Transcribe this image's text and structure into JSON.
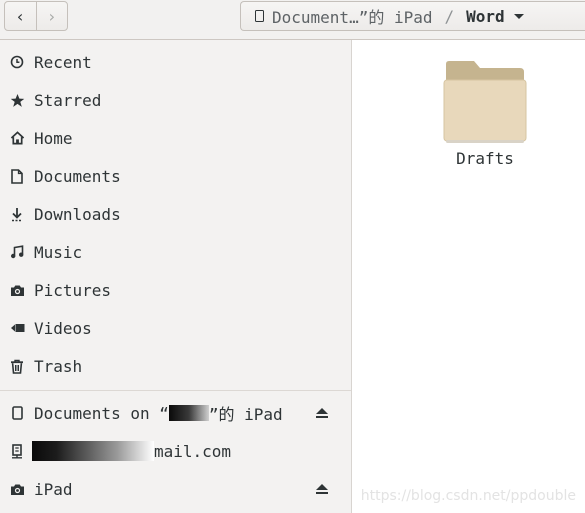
{
  "header": {
    "back_icon": "‹",
    "forward_icon": "›",
    "path_device": "Document…”的 iPad",
    "path_separator": "/",
    "path_current": "Word"
  },
  "sidebar": {
    "places": [
      {
        "label": "Recent",
        "icon": "clock-icon"
      },
      {
        "label": "Starred",
        "icon": "star-icon"
      },
      {
        "label": "Home",
        "icon": "home-icon"
      },
      {
        "label": "Documents",
        "icon": "document-icon"
      },
      {
        "label": "Downloads",
        "icon": "download-icon"
      },
      {
        "label": "Music",
        "icon": "music-icon"
      },
      {
        "label": "Pictures",
        "icon": "camera-icon"
      },
      {
        "label": "Videos",
        "icon": "video-icon"
      },
      {
        "label": "Trash",
        "icon": "trash-icon"
      }
    ],
    "devices": [
      {
        "label_prefix": "Documents on “",
        "label_suffix": "”的 iPad",
        "icon": "tablet-icon",
        "ejectable": true
      },
      {
        "label_suffix": "mail.com",
        "icon": "network-icon",
        "ejectable": false
      },
      {
        "label": "iPad",
        "icon": "camera-icon",
        "ejectable": true
      }
    ]
  },
  "main": {
    "items": [
      {
        "label": "Drafts",
        "icon": "folder-icon"
      }
    ]
  },
  "watermark": "https://blog.csdn.net/ppdouble"
}
